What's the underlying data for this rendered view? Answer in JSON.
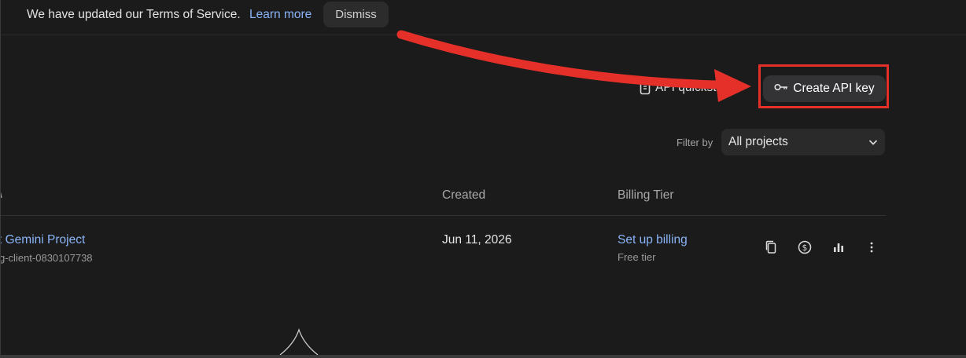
{
  "banner": {
    "message": "We have updated our Terms of Service.",
    "learn_more": "Learn more",
    "dismiss": "Dismiss"
  },
  "actions": {
    "quickstart_label": "API quickstart",
    "create_key_label": "Create API key"
  },
  "filter": {
    "label": "Filter by",
    "selected": "All projects"
  },
  "table": {
    "headers": {
      "created": "Created",
      "billing_tier": "Billing Tier"
    },
    "rows": [
      {
        "name": "Gemini Project",
        "name_prefix_fragment": "t",
        "project_id": "g-client-0830107738",
        "created": "Jun 11, 2026",
        "billing_action": "Set up billing",
        "tier": "Free tier"
      }
    ]
  },
  "colors": {
    "background": "#1b1b1b",
    "link": "#8ab4f8",
    "annotation": "#e5302a"
  },
  "icons": {
    "quickstart": "document-icon",
    "create_key": "key-icon",
    "dropdown": "chevron-down-icon",
    "row_actions": [
      "copy-icon",
      "billing-dollar-icon",
      "bar-chart-icon",
      "more-vert-icon"
    ]
  }
}
